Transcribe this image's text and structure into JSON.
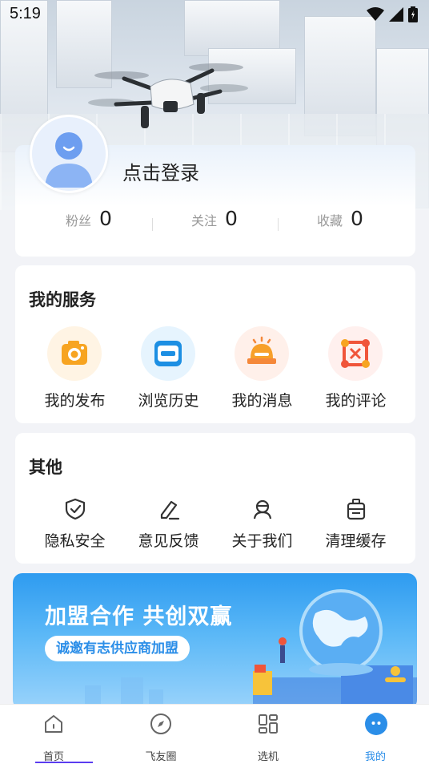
{
  "status_bar": {
    "time": "5:19"
  },
  "profile": {
    "login_label": "点击登录",
    "stats": [
      {
        "label": "粉丝",
        "value": "0"
      },
      {
        "label": "关注",
        "value": "0"
      },
      {
        "label": "收藏",
        "value": "0"
      }
    ]
  },
  "services": {
    "title": "我的服务",
    "items": [
      {
        "label": "我的发布",
        "icon": "camera-icon",
        "color": "#f7a421"
      },
      {
        "label": "浏览历史",
        "icon": "history-icon",
        "color": "#1d8fe3"
      },
      {
        "label": "我的消息",
        "icon": "message-icon",
        "color": "#f5883a"
      },
      {
        "label": "我的评论",
        "icon": "comment-icon",
        "color": "#f0553a"
      }
    ]
  },
  "others": {
    "title": "其他",
    "items": [
      {
        "label": "隐私安全",
        "icon": "shield-check-icon"
      },
      {
        "label": "意见反馈",
        "icon": "edit-feedback-icon"
      },
      {
        "label": "关于我们",
        "icon": "headset-icon"
      },
      {
        "label": "清理缓存",
        "icon": "trash-icon"
      }
    ]
  },
  "banner": {
    "title": "加盟合作 共创双赢",
    "button_label": "诚邀有志供应商加盟"
  },
  "tabs": [
    {
      "label": "首页",
      "icon": "home-icon"
    },
    {
      "label": "飞友圈",
      "icon": "compass-icon"
    },
    {
      "label": "选机",
      "icon": "grid-icon"
    },
    {
      "label": "我的",
      "icon": "profile-icon",
      "active": true
    }
  ],
  "colors": {
    "accent": "#2b8ee8",
    "background": "#f2f3f7"
  }
}
